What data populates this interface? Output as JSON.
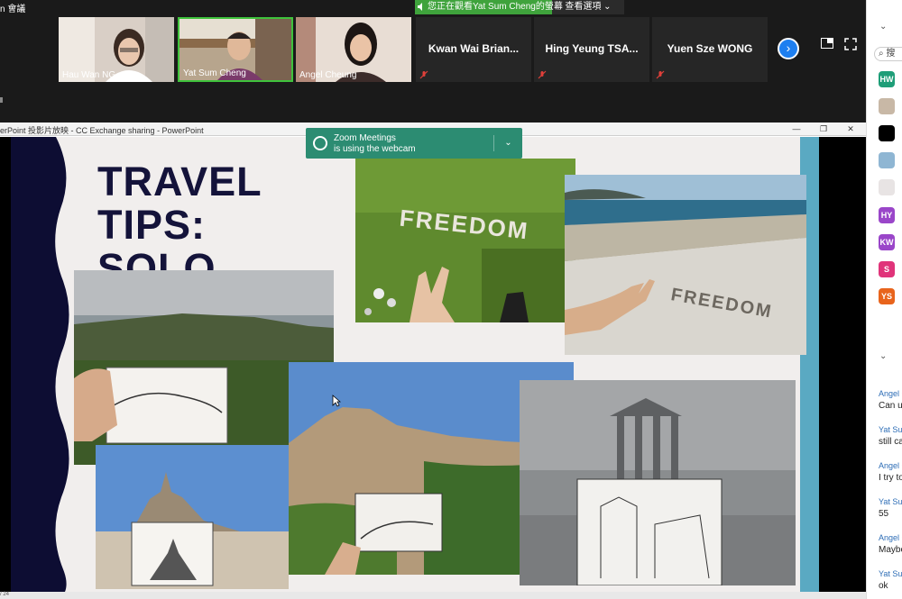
{
  "top": {
    "meeting_title": "n 會議",
    "share_banner_text": "您正在觀看Yat Sum Cheng的螢幕",
    "view_options": "查看選項 ⌄"
  },
  "gallery": {
    "participants": [
      {
        "name": "Hau Wan NG",
        "video": true
      },
      {
        "name": "Yat Sum Cheng",
        "video": true,
        "active_speaker": true
      },
      {
        "name": "Angel Cheung",
        "video": true
      },
      {
        "name": "Kwan Wai Brian...",
        "video": false,
        "muted": true
      },
      {
        "name": "Hing Yeung TSA...",
        "video": false,
        "muted": true
      },
      {
        "name": "Yuen Sze WONG",
        "video": false,
        "muted": true
      }
    ],
    "next_page_icon": "chevron-right-icon"
  },
  "ppt": {
    "window_title": "erPoint 投影片放映  -  CC Exchange sharing - PowerPoint",
    "page_indicator": "/ 24",
    "slide": {
      "title_line1": "TRAVEL TIPS:",
      "title_line2": "SOLO TRAVEL",
      "photo1_text": "FREEDOM",
      "photo2_text": "FREEDOM"
    }
  },
  "toast": {
    "title": "Zoom Meetings",
    "body": "is using the webcam"
  },
  "panel": {
    "search_placeholder": "搜",
    "avatars": [
      {
        "initials": "HW",
        "color": "#1f9e78"
      },
      {
        "initials": "",
        "color": "#c8b8a6"
      },
      {
        "initials": "",
        "color": "#000000"
      },
      {
        "initials": "",
        "color": "#8fb6d3"
      },
      {
        "initials": "",
        "color": "#e8e4e4"
      },
      {
        "initials": "HY",
        "color": "#9a46c9"
      },
      {
        "initials": "KW",
        "color": "#9a46c9"
      },
      {
        "initials": "S",
        "color": "#e0347a"
      },
      {
        "initials": "YS",
        "color": "#e8641c"
      }
    ],
    "chat": [
      {
        "name": "Angel C",
        "msg": "Can u"
      },
      {
        "name": "Yat Sun",
        "msg": "still ca"
      },
      {
        "name": "Angel C",
        "msg": "I try to"
      },
      {
        "name": "Yat Sun",
        "msg": "55"
      },
      {
        "name": "Angel C",
        "msg": "Maybe"
      },
      {
        "name": "Yat Sun",
        "msg": "ok"
      }
    ]
  },
  "colors": {
    "zoom_green": "#3fa33c",
    "toast_teal": "#2c8c72",
    "slide_navy": "#14133a",
    "slide_accent": "#5aa9c2"
  }
}
